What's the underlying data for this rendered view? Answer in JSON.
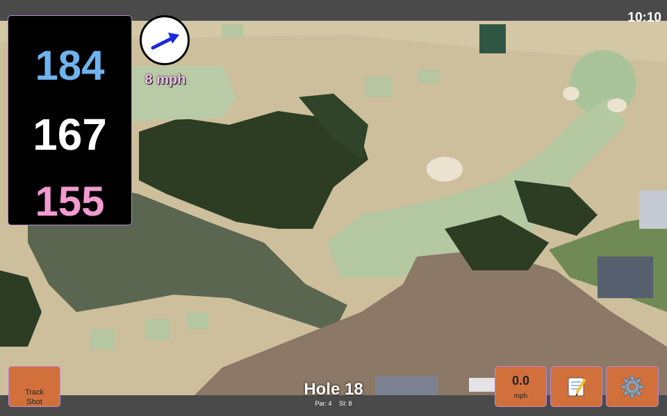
{
  "status": {
    "time": "10:10"
  },
  "yardages": {
    "back": "184",
    "middle": "167",
    "front": "155"
  },
  "wind": {
    "speed": "8 mph",
    "arrow_icon": "arrow-icon"
  },
  "hole": {
    "title": "Hole 18",
    "par": "Par: 4",
    "si": "SI: 8"
  },
  "buttons": {
    "track_shot": "Track\nShot",
    "speed_value": "0.0",
    "speed_unit": "mph",
    "notes_icon": "notepad-icon",
    "settings_icon": "gear-icon"
  },
  "colors": {
    "button_bg": "#d2703c",
    "back": "#6fb3ee",
    "middle": "#ffffff",
    "front": "#f39ad0",
    "wind_text": "#f6c3f2"
  }
}
